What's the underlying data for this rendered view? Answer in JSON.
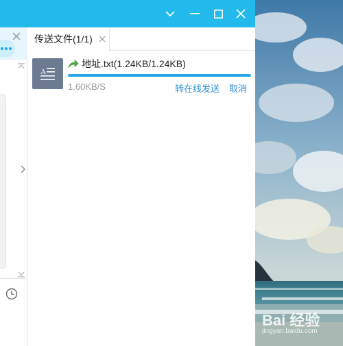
{
  "window": {
    "buttons": [
      "dropdown",
      "minimize",
      "maximize",
      "close"
    ],
    "accent_color": "#22b9ec"
  },
  "left_pane": {
    "icons": [
      "close-icon",
      "more-dots-icon",
      "collapse-up-icon",
      "expand-right-icon",
      "collapse-down-icon",
      "history-clock-icon"
    ]
  },
  "transfer_panel": {
    "tab": {
      "label": "传送文件(1/1)",
      "close_icon": "close-icon"
    },
    "file": {
      "name": "地址.txt(1.24KB/1.24KB)",
      "icon": "text-file-icon",
      "status_icon": "green-arrow-icon",
      "progress": 1.0,
      "speed": "1.60KB/S",
      "actions": {
        "offline": "转在线发送",
        "cancel": "取消"
      }
    }
  },
  "wallpaper": {
    "watermark_logo": "Bai 经验",
    "watermark_url": "jingyan.baidu.com"
  }
}
